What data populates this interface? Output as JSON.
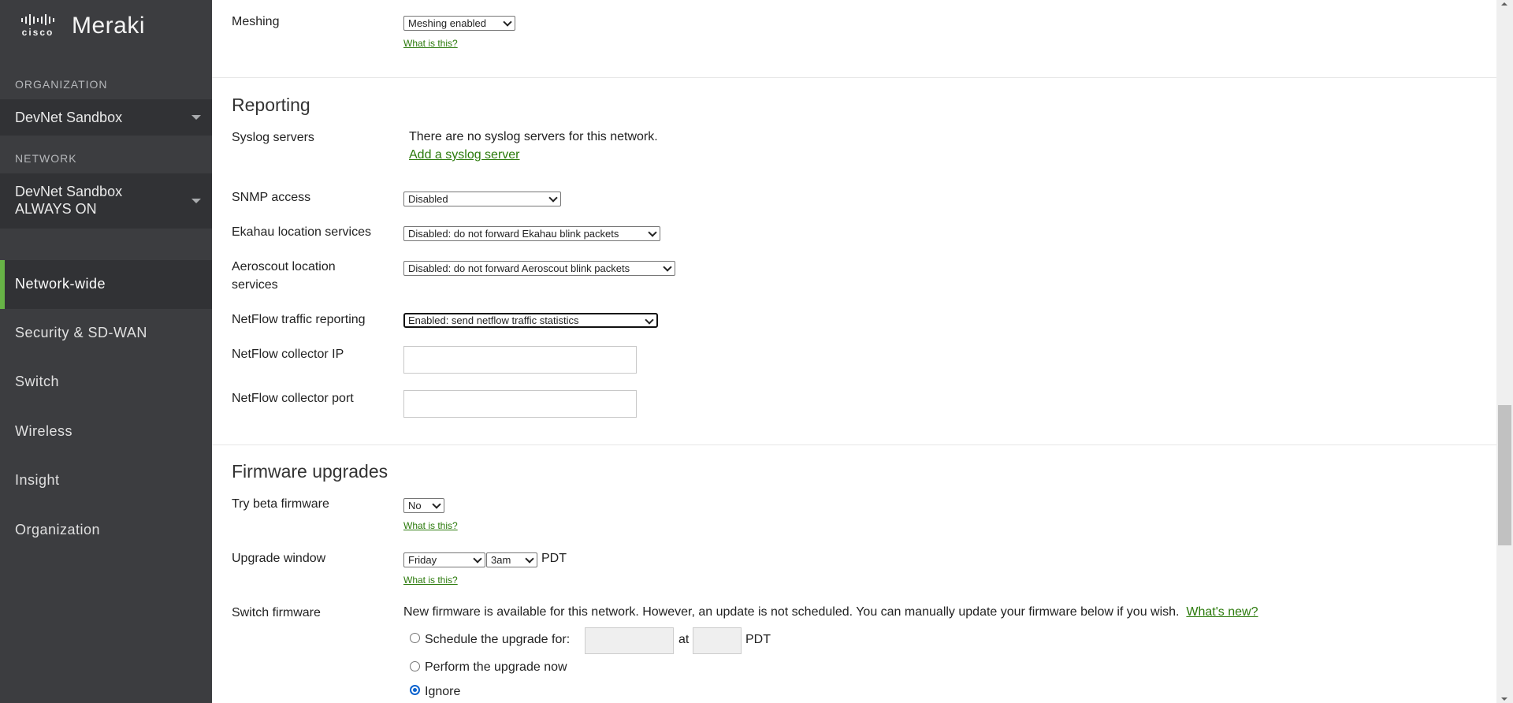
{
  "sidebar": {
    "logo": {
      "cisco": "cisco",
      "product": "Meraki"
    },
    "organization_label": "ORGANIZATION",
    "organization_value": "DevNet Sandbox",
    "network_label": "NETWORK",
    "network_value_line1": "DevNet Sandbox",
    "network_value_line2": "ALWAYS ON",
    "nav": [
      {
        "label": "Network-wide",
        "active": true
      },
      {
        "label": "Security & SD-WAN",
        "active": false
      },
      {
        "label": "Switch",
        "active": false
      },
      {
        "label": "Wireless",
        "active": false
      },
      {
        "label": "Insight",
        "active": false
      },
      {
        "label": "Organization",
        "active": false
      }
    ],
    "accent_color": "#67b346"
  },
  "main": {
    "meshing": {
      "label": "Meshing",
      "value": "Meshing enabled",
      "help": "What is this?"
    },
    "reporting": {
      "title": "Reporting",
      "syslog": {
        "label": "Syslog servers",
        "text": "There are no syslog servers for this network.",
        "link": "Add a syslog server"
      },
      "snmp": {
        "label": "SNMP access",
        "value": "Disabled"
      },
      "ekahau": {
        "label": "Ekahau location services",
        "value": "Disabled: do not forward Ekahau blink packets"
      },
      "aeroscout": {
        "label_line1": "Aeroscout location",
        "label_line2": "services",
        "value": "Disabled: do not forward Aeroscout blink packets"
      },
      "netflow": {
        "label": "NetFlow traffic reporting",
        "value": "Enabled: send netflow traffic statistics"
      },
      "collector_ip": {
        "label": "NetFlow collector IP",
        "value": ""
      },
      "collector_port": {
        "label": "NetFlow collector port",
        "value": ""
      }
    },
    "firmware": {
      "title": "Firmware upgrades",
      "beta": {
        "label": "Try beta firmware",
        "value": "No",
        "help": "What is this?"
      },
      "window": {
        "label": "Upgrade window",
        "day": "Friday",
        "time": "3am",
        "tz": "PDT",
        "help": "What is this?"
      },
      "switch": {
        "label": "Switch firmware",
        "notice": "New firmware is available for this network. However, an update is not scheduled. You can manually update your firmware below if you wish.",
        "whats_new": "What's new?",
        "options": {
          "schedule": "Schedule the upgrade for:",
          "at": "at",
          "tz": "PDT",
          "now": "Perform the upgrade now",
          "ignore": "Ignore"
        },
        "selected": "ignore"
      }
    },
    "link_color": "#2b7a0b"
  }
}
